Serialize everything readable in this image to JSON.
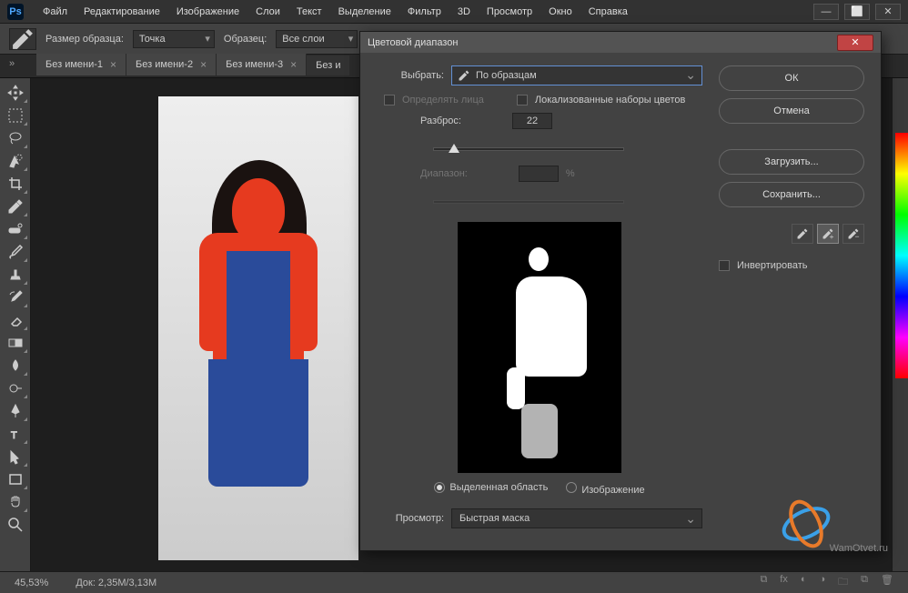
{
  "menubar": {
    "items": [
      "Файл",
      "Редактирование",
      "Изображение",
      "Слои",
      "Текст",
      "Выделение",
      "Фильтр",
      "3D",
      "Просмотр",
      "Окно",
      "Справка"
    ]
  },
  "options": {
    "sample_size_label": "Размер образца:",
    "sample_size_value": "Точка",
    "sample_label": "Образец:",
    "sample_value": "Все слои"
  },
  "tabs": [
    {
      "label": "Без имени-1",
      "active": false
    },
    {
      "label": "Без имени-2",
      "active": false
    },
    {
      "label": "Без имени-3",
      "active": false
    },
    {
      "label": "Без и",
      "active": true
    }
  ],
  "statusbar": {
    "zoom": "45,53%",
    "doc_info": "Док: 2,35M/3,13M"
  },
  "dialog": {
    "title": "Цветовой диапазон",
    "select_label": "Выбрать:",
    "select_value": "По образцам",
    "detect_faces": "Определять лица",
    "localized": "Локализованные наборы цветов",
    "fuzziness_label": "Разброс:",
    "fuzziness_value": "22",
    "range_label": "Диапазон:",
    "range_unit": "%",
    "radio_selection": "Выделенная область",
    "radio_image": "Изображение",
    "preview_label": "Просмотр:",
    "preview_value": "Быстрая маска",
    "invert": "Инвертировать",
    "buttons": {
      "ok": "ОК",
      "cancel": "Отмена",
      "load": "Загрузить...",
      "save": "Сохранить..."
    }
  },
  "watermark": "WamOtvet.ru"
}
